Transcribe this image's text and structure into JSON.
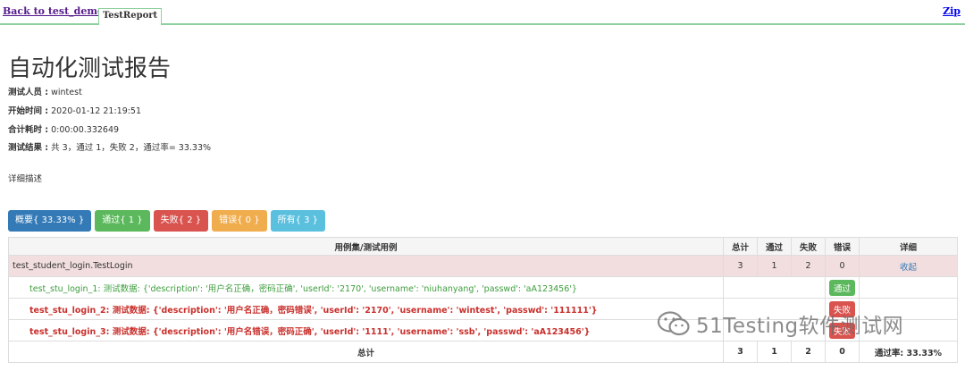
{
  "topbar": {
    "back_label": "Back to test_demo",
    "tab_label": "TestReport",
    "zip_label": "Zip"
  },
  "report": {
    "title": "自动化测试报告",
    "tester_label": "测试人员 :",
    "tester_value": " wintest",
    "start_label": "开始时间 :",
    "start_value": " 2020-01-12 21:19:51",
    "duration_label": "合计耗时 :",
    "duration_value": " 0:00:00.332649",
    "result_label": "测试结果 :",
    "result_value": " 共 3，通过 1，失败 2，通过率= 33.33%",
    "description": "详细描述"
  },
  "filters": {
    "overview": "概要{ 33.33% }",
    "pass": "通过{ 1 }",
    "fail": "失败{ 2 }",
    "error": "错误{ 0 }",
    "all": "所有{ 3 }"
  },
  "table": {
    "headers": {
      "name": "用例集/测试用例",
      "total": "总计",
      "pass": "通过",
      "fail": "失败",
      "error": "错误",
      "detail": "详细"
    },
    "class_row": {
      "name": "test_student_login.TestLogin",
      "total": "3",
      "pass": "1",
      "fail": "2",
      "error": "0",
      "action": "收起"
    },
    "cases": [
      {
        "name": "test_stu_login_1: 测试数据: {'description': '用户名正确，密码正确', 'userId': '2170', 'username': 'niuhanyang', 'passwd': 'aA123456'}",
        "status": "通过"
      },
      {
        "name": "test_stu_login_2: 测试数据: {'description': '用户名正确，密码错误', 'userId': '2170', 'username': 'wintest', 'passwd': '111111'}",
        "status": "失败"
      },
      {
        "name": "test_stu_login_3: 测试数据: {'description': '用户名错误，密码正确', 'userId': '1111', 'username': 'ssb', 'passwd': 'aA123456'}",
        "status": "失败"
      }
    ],
    "total_row": {
      "label": "总计",
      "total": "3",
      "pass": "1",
      "fail": "2",
      "error": "0",
      "rate": "通过率: 33.33%"
    }
  },
  "watermark": {
    "text": "51Testing软件测试网"
  },
  "colors": {
    "pass": "#5cb85c",
    "fail": "#d9534f",
    "error": "#f0ad4e",
    "overview": "#337ab7",
    "all": "#5bc0de",
    "class_row_bg": "#f2dede"
  }
}
